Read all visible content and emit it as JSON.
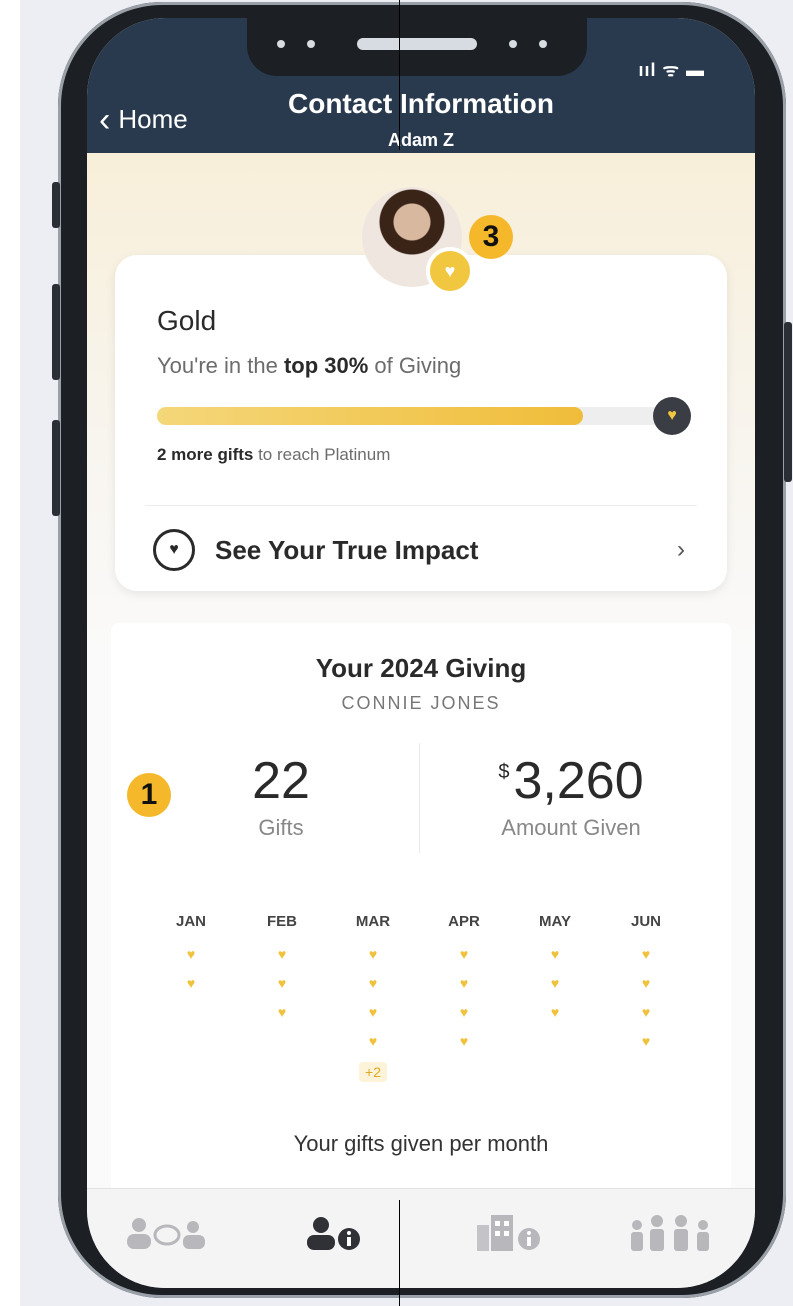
{
  "status": {
    "indicators": "ııl ᯤ ▬"
  },
  "nav": {
    "back_label": "Home",
    "title": "Contact Information",
    "subtitle": "Adam Z"
  },
  "callouts": {
    "avatar": "3",
    "stats": "1"
  },
  "tier_card": {
    "tier": "Gold",
    "percent_prefix": "You're in the ",
    "percent_bold": "top 30%",
    "percent_suffix": " of Giving",
    "progress": 0.82,
    "more_bold": "2 more gifts",
    "more_suffix": " to reach Platinum",
    "impact_label": "See Your True Impact"
  },
  "giving": {
    "title": "Your 2024 Giving",
    "name": "CONNIE JONES",
    "gifts_value": "22",
    "gifts_label": "Gifts",
    "currency_symbol": "$",
    "amount_value": "3,260",
    "amount_label": "Amount Given",
    "footer": "Your gifts given per month",
    "months": [
      {
        "label": "JAN",
        "hearts": 2,
        "extra": ""
      },
      {
        "label": "FEB",
        "hearts": 3,
        "extra": ""
      },
      {
        "label": "MAR",
        "hearts": 4,
        "extra": "+2"
      },
      {
        "label": "APR",
        "hearts": 4,
        "extra": ""
      },
      {
        "label": "MAY",
        "hearts": 3,
        "extra": ""
      },
      {
        "label": "JUN",
        "hearts": 4,
        "extra": ""
      }
    ]
  },
  "tabs": [
    {
      "name": "tab-contacts",
      "icon": "people-chat-icon"
    },
    {
      "name": "tab-contact-info",
      "icon": "person-info-icon"
    },
    {
      "name": "tab-organization",
      "icon": "building-info-icon"
    },
    {
      "name": "tab-family",
      "icon": "family-icon"
    }
  ],
  "colors": {
    "header": "#293a4f",
    "gold": "#f0c23c",
    "callout": "#f5b82a"
  }
}
